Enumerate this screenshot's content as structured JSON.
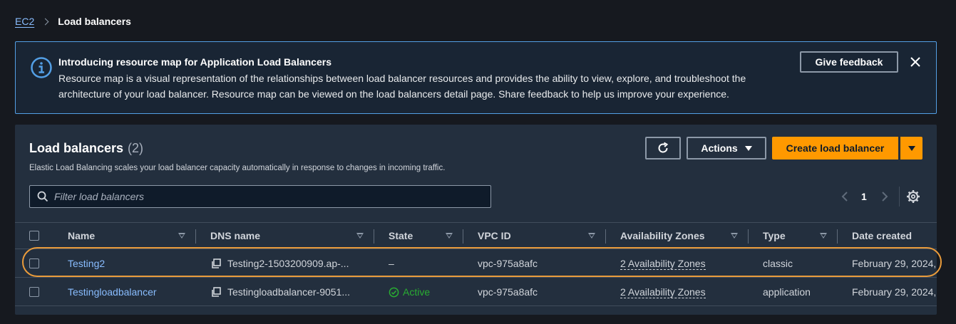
{
  "breadcrumb": {
    "root": "EC2",
    "current": "Load balancers"
  },
  "flash": {
    "title": "Introducing resource map for Application Load Balancers",
    "text": "Resource map is a visual representation of the relationships between load balancer resources and provides the ability to view, explore, and troubleshoot the architecture of your load balancer. Resource map can be viewed on the load balancers detail page. Share feedback to help us improve your experience.",
    "feedback_label": "Give feedback",
    "icon": "info-icon"
  },
  "header": {
    "title": "Load balancers",
    "count": "(2)",
    "description": "Elastic Load Balancing scales your load balancer capacity automatically in response to changes in incoming traffic."
  },
  "toolbar": {
    "actions_label": "Actions",
    "create_label": "Create load balancer"
  },
  "filter": {
    "placeholder": "Filter load balancers"
  },
  "pagination": {
    "page": "1"
  },
  "table": {
    "columns": [
      "Name",
      "DNS name",
      "State",
      "VPC ID",
      "Availability Zones",
      "Type",
      "Date created"
    ],
    "rows": [
      {
        "name": "Testing2",
        "dns": "Testing2-1503200909.ap-...",
        "state": "–",
        "vpc": "vpc-975a8afc",
        "az": "2 Availability Zones",
        "type": "classic",
        "date": "February 29, 2024,",
        "highlighted": true
      },
      {
        "name": "Testingloadbalancer",
        "dns": "Testingloadbalancer-9051...",
        "state": "Active",
        "vpc": "vpc-975a8afc",
        "az": "2 Availability Zones",
        "type": "application",
        "date": "February 29, 2024,",
        "highlighted": false
      }
    ]
  },
  "colors": {
    "accent": "#ff9900",
    "link": "#89bdff",
    "info_border": "#539fe5",
    "active": "#29ad32",
    "highlight": "#e99b3b"
  }
}
